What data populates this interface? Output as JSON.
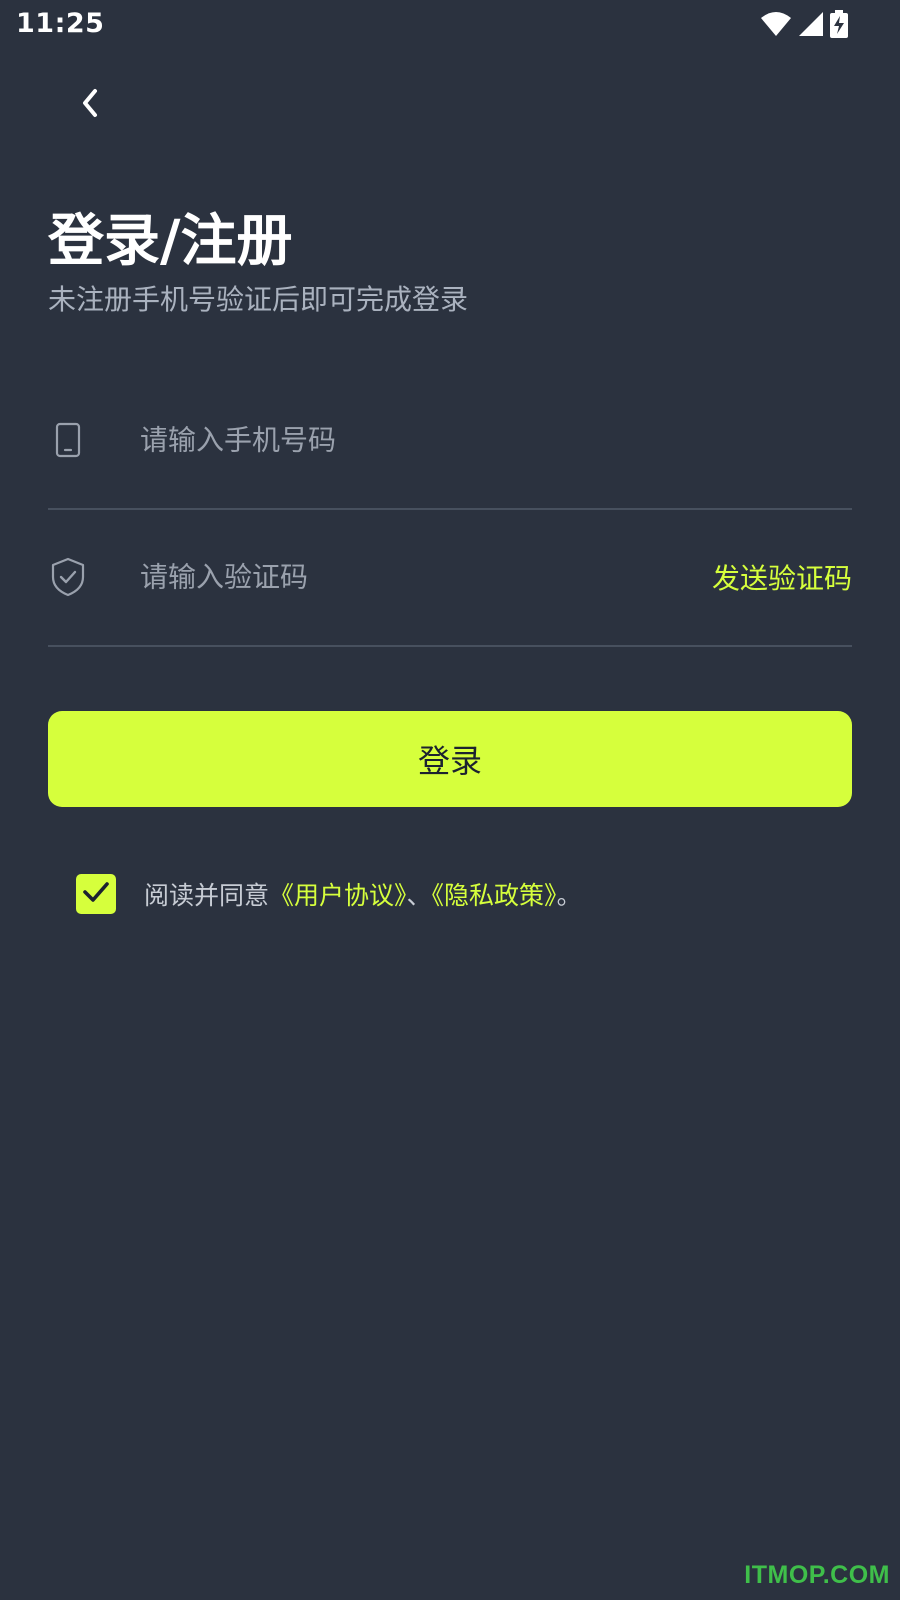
{
  "status_bar": {
    "time": "11:25",
    "icons": [
      "wifi-icon",
      "signal-icon",
      "battery-charging-icon"
    ]
  },
  "nav": {
    "back_icon": "chevron-left-icon"
  },
  "header": {
    "title": "登录/注册",
    "subtitle": "未注册手机号验证后即可完成登录"
  },
  "form": {
    "phone": {
      "icon": "mobile-phone-icon",
      "placeholder": "请输入手机号码",
      "value": ""
    },
    "code": {
      "icon": "shield-check-icon",
      "placeholder": "请输入验证码",
      "value": "",
      "send_label": "发送验证码"
    },
    "login_label": "登录"
  },
  "agreement": {
    "checked": true,
    "prefix": "阅读并同意",
    "user_agreement": "《用户协议》",
    "separator": "、",
    "privacy_policy": "《隐私政策》",
    "suffix": "。"
  },
  "watermark": "ITMOP.COM",
  "colors": {
    "background": "#2b323f",
    "accent": "#d6ff3c",
    "divider": "#47505e",
    "placeholder": "#9aa1ad",
    "watermark": "#3fbf4a"
  }
}
